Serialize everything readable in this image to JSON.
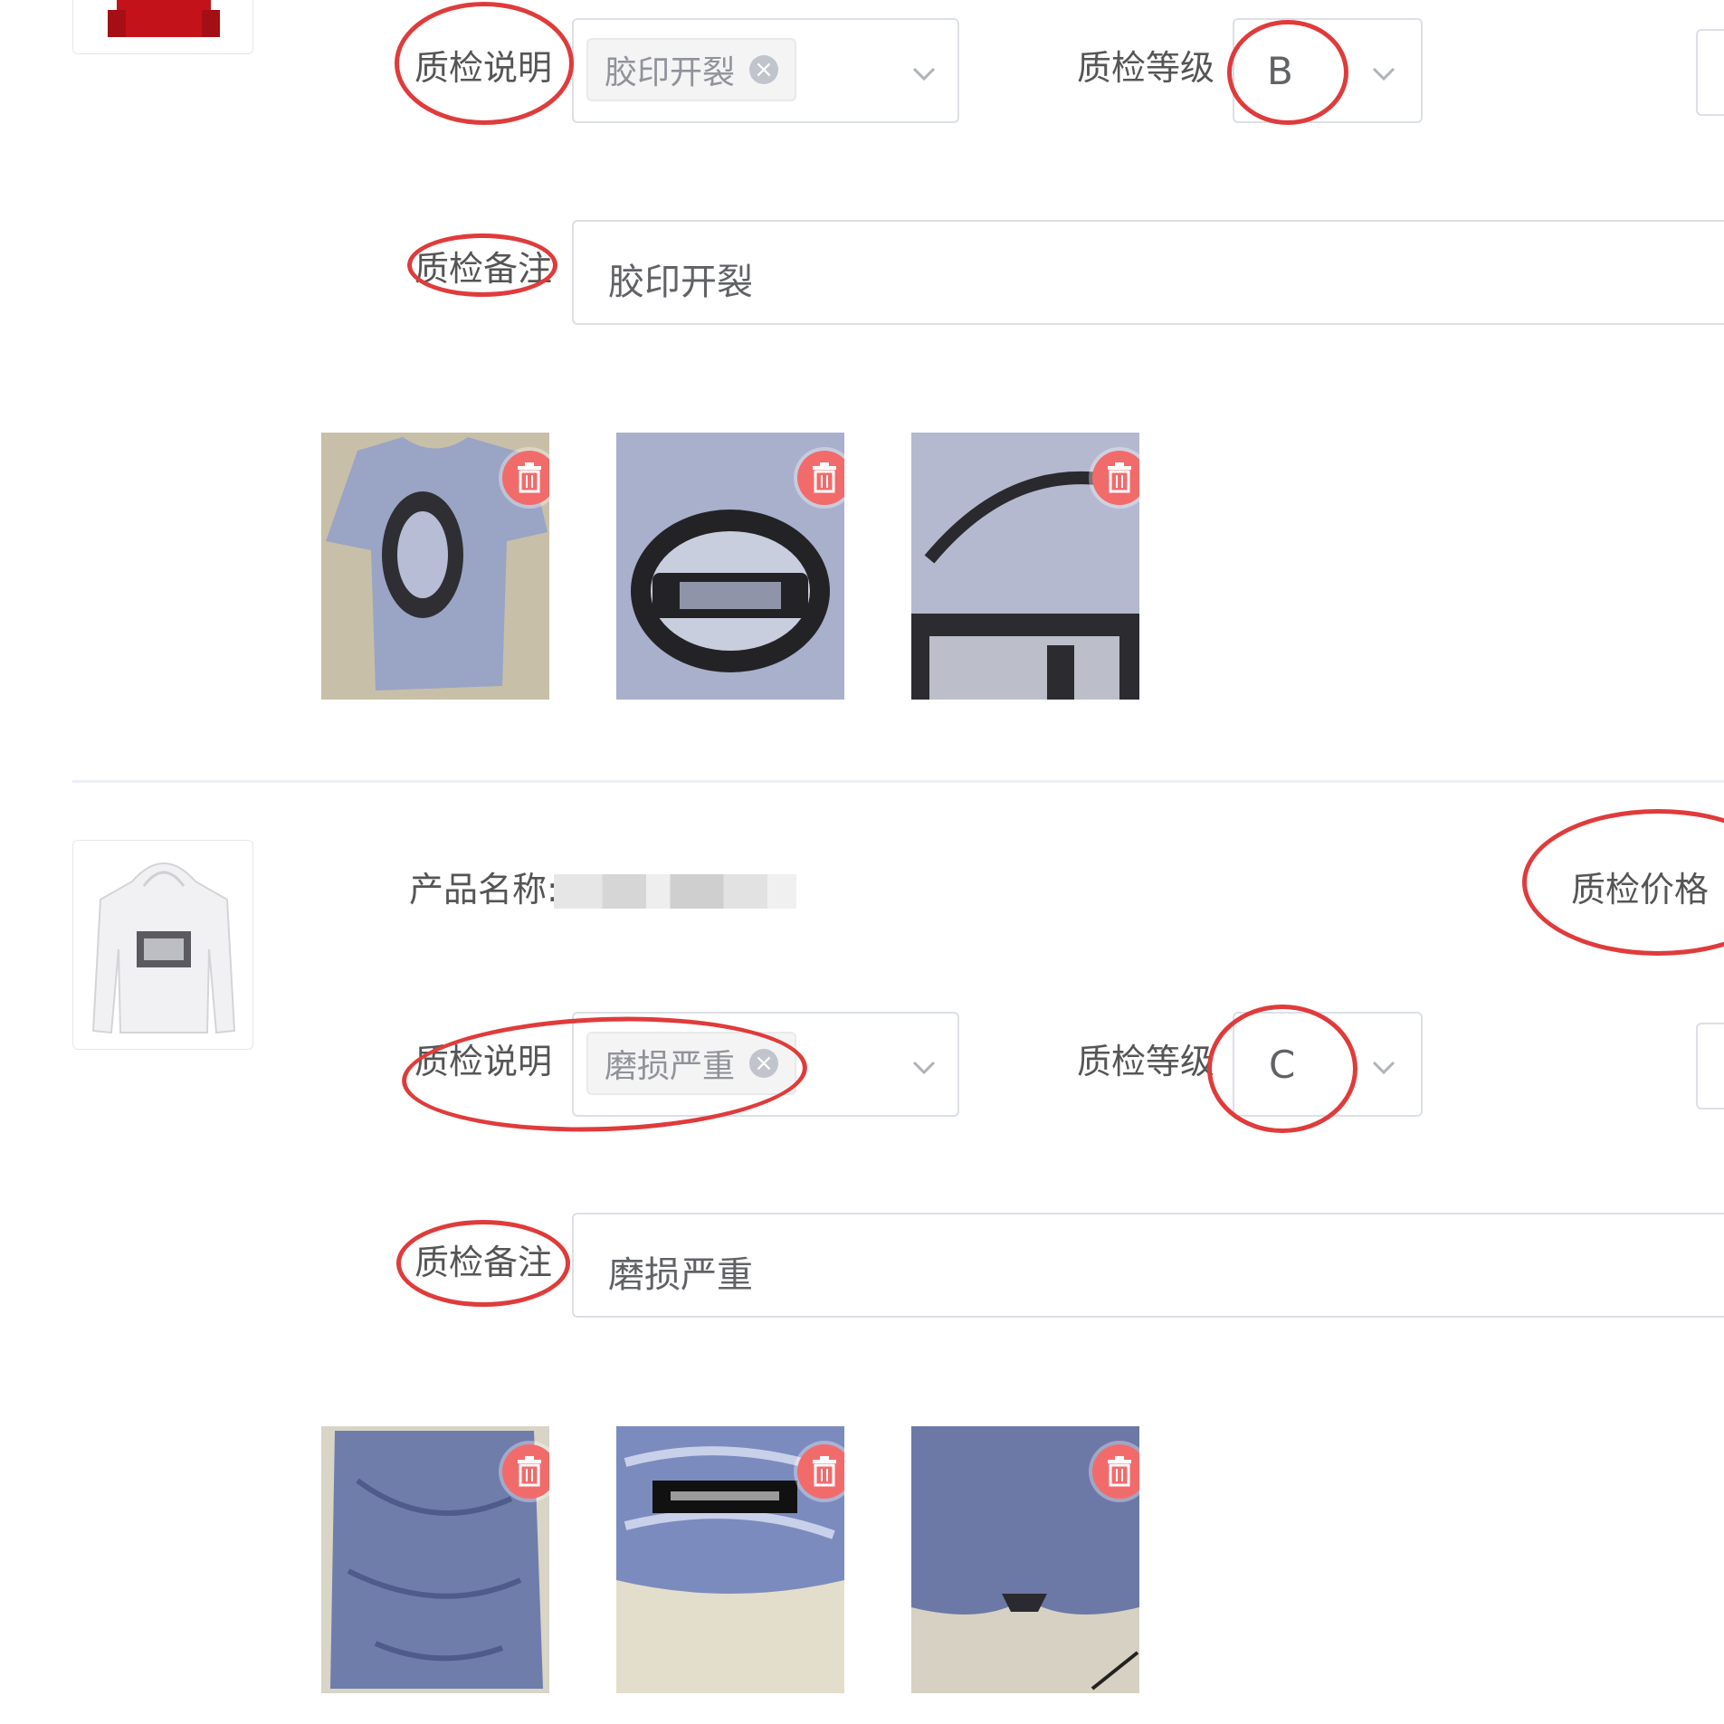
{
  "items": [
    {
      "qc_desc_label": "质检说明",
      "qc_desc_tag": "胶印开裂",
      "qc_grade_label": "质检等级",
      "qc_grade_value": "B",
      "qc_note_label": "质检备注",
      "qc_note_value": "胶印开裂"
    },
    {
      "product_name_label": "产品名称:",
      "qc_price_label": "质检价格",
      "qc_desc_label": "质检说明",
      "qc_desc_tag": "磨损严重",
      "qc_grade_label": "质检等级",
      "qc_grade_value": "C",
      "qc_note_label": "质检备注",
      "qc_note_value": "磨损严重"
    }
  ],
  "colors": {
    "annotation_red": "#e03b3b",
    "delete_button": "#f26b6b",
    "border": "#dcdfe6"
  },
  "icons": [
    "chevron-down-icon",
    "tag-close-icon",
    "trash-icon"
  ]
}
